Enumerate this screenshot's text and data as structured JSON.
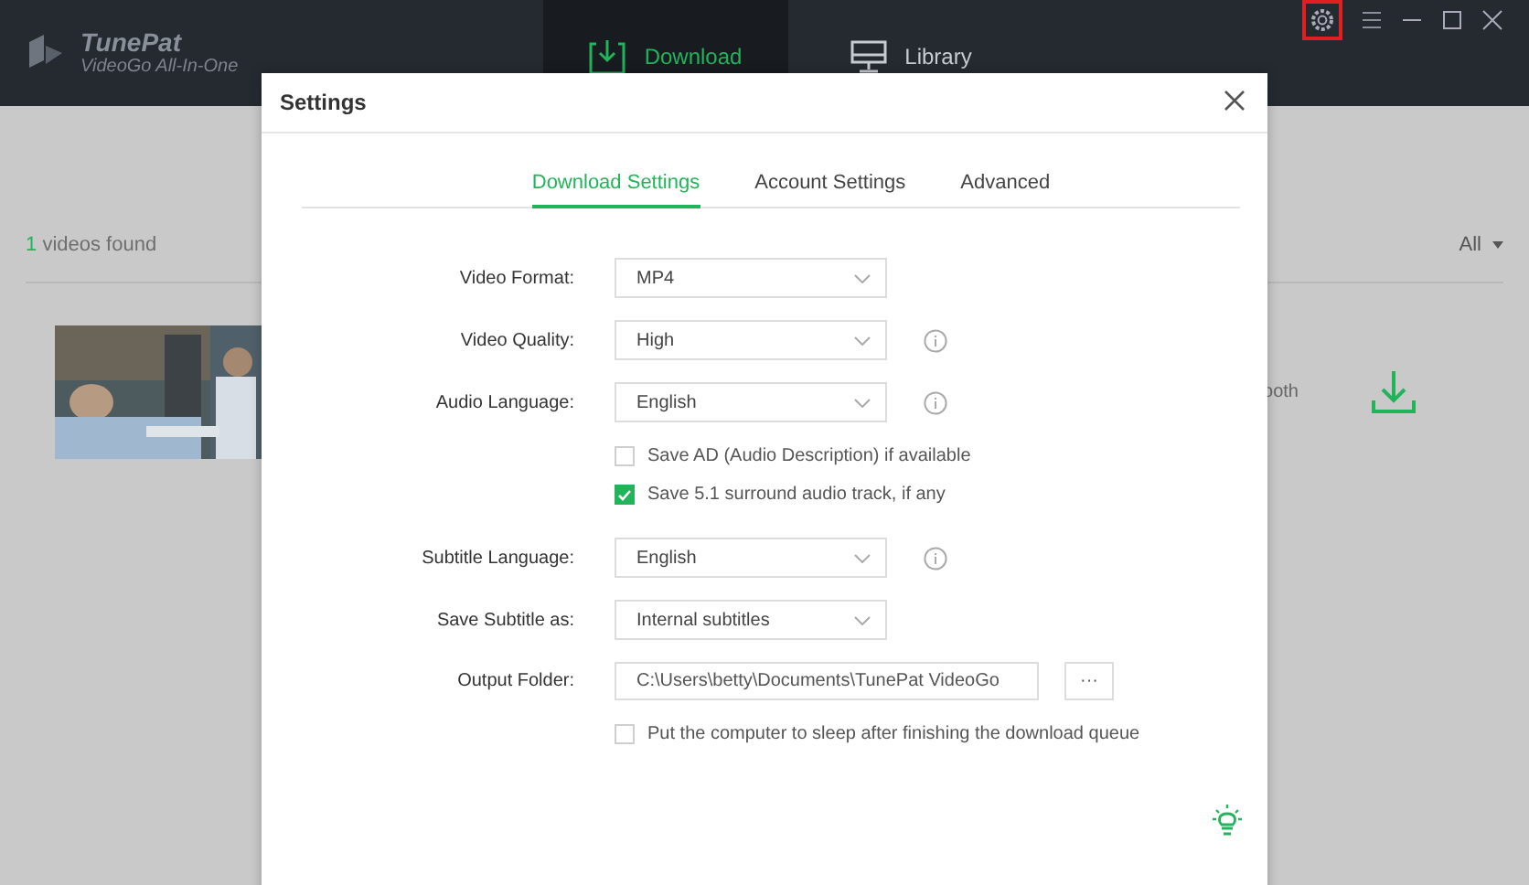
{
  "app": {
    "name": "TunePat",
    "subtitle": "VideoGo All-In-One"
  },
  "nav_tabs": [
    {
      "label": "Download",
      "selected": true
    },
    {
      "label": "Library",
      "selected": false
    }
  ],
  "window_controls": {
    "settings_highlighted": true
  },
  "results": {
    "count": "1",
    "label": "videos found",
    "filter": "All"
  },
  "video": {
    "partial_text": "ooth"
  },
  "dialog": {
    "title": "Settings",
    "tabs": [
      {
        "label": "Download Settings",
        "selected": true
      },
      {
        "label": "Account Settings",
        "selected": false
      },
      {
        "label": "Advanced",
        "selected": false
      }
    ],
    "fields": [
      {
        "kind": "select",
        "label": "Video Format:",
        "value": "MP4",
        "info": false
      },
      {
        "kind": "select",
        "label": "Video Quality:",
        "value": "High",
        "info": true
      },
      {
        "kind": "select",
        "label": "Audio Language:",
        "value": "English",
        "info": true
      },
      {
        "kind": "checkbox",
        "label": "Save AD (Audio Description) if available",
        "checked": false
      },
      {
        "kind": "checkbox",
        "label": "Save 5.1 surround audio track, if any",
        "checked": true
      },
      {
        "kind": "select",
        "label": "Subtitle Language:",
        "value": "English",
        "info": true
      },
      {
        "kind": "select",
        "label": "Save Subtitle as:",
        "value": "Internal subtitles",
        "info": false
      },
      {
        "kind": "path",
        "label": "Output Folder:",
        "value": "C:\\Users\\betty\\Documents\\TunePat VideoGo",
        "button": "···"
      },
      {
        "kind": "checkbox",
        "label": "Put the computer to sleep after finishing the download queue",
        "checked": false
      }
    ]
  }
}
